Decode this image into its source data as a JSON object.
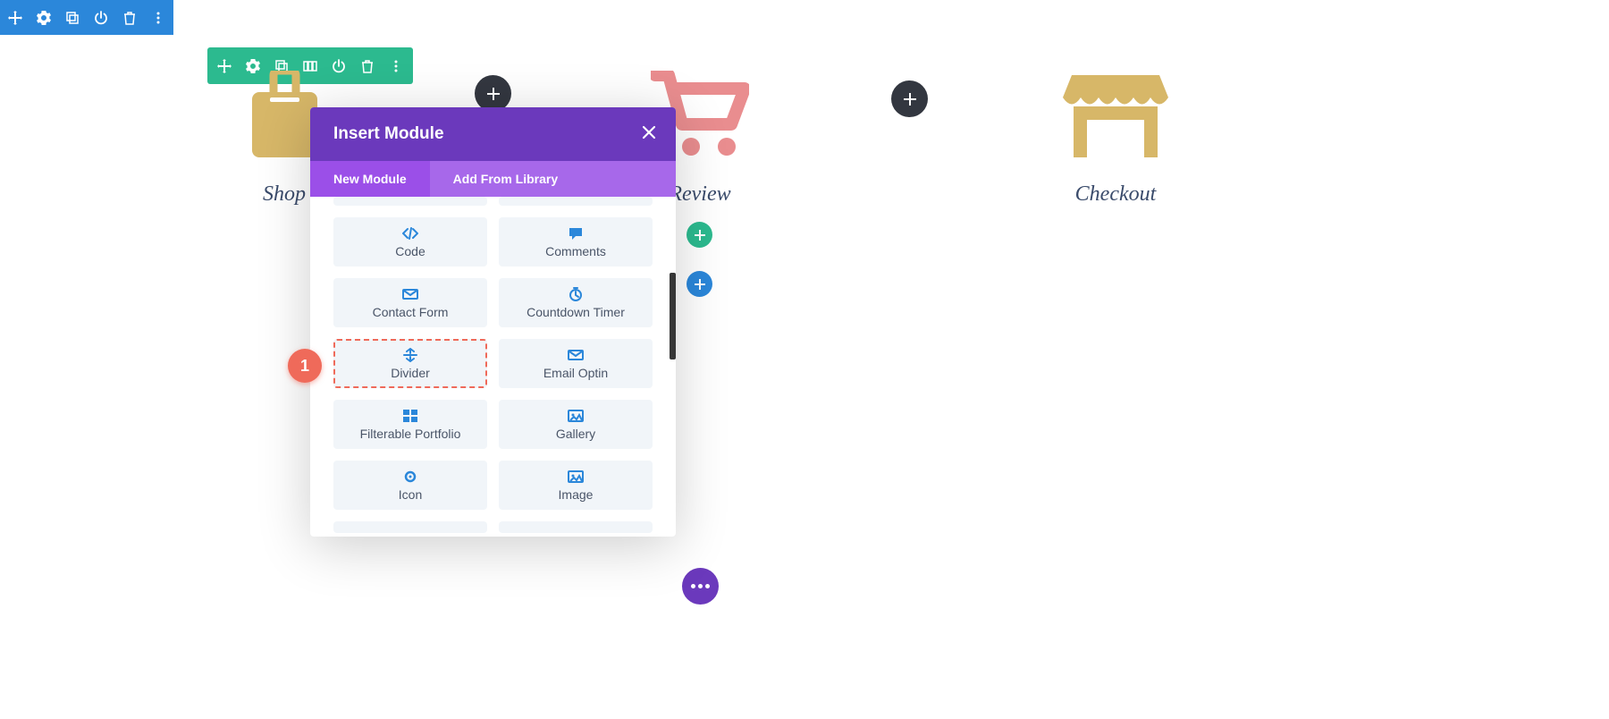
{
  "columns": {
    "shop": {
      "label": "Shop"
    },
    "review": {
      "label": "Review"
    },
    "checkout": {
      "label": "Checkout"
    }
  },
  "modal": {
    "title": "Insert Module",
    "tabs": {
      "new": "New Module",
      "library": "Add From Library"
    },
    "modules": [
      {
        "icon": "code",
        "label": "Code"
      },
      {
        "icon": "chat",
        "label": "Comments"
      },
      {
        "icon": "mail",
        "label": "Contact Form"
      },
      {
        "icon": "clock",
        "label": "Countdown Timer"
      },
      {
        "icon": "divider",
        "label": "Divider",
        "highlighted": true
      },
      {
        "icon": "mail",
        "label": "Email Optin"
      },
      {
        "icon": "grid",
        "label": "Filterable Portfolio"
      },
      {
        "icon": "image",
        "label": "Gallery"
      },
      {
        "icon": "circle",
        "label": "Icon"
      },
      {
        "icon": "image",
        "label": "Image"
      }
    ]
  },
  "callout": "1",
  "colors": {
    "blue": "#2b87da",
    "green": "#2cba8f",
    "purpleDark": "#6b39bc",
    "purpleMid": "#9b4fe8",
    "purpleLight": "#a768ea",
    "beige": "#d7b768",
    "pink": "#e98d8f",
    "red": "#ef6a5a"
  }
}
